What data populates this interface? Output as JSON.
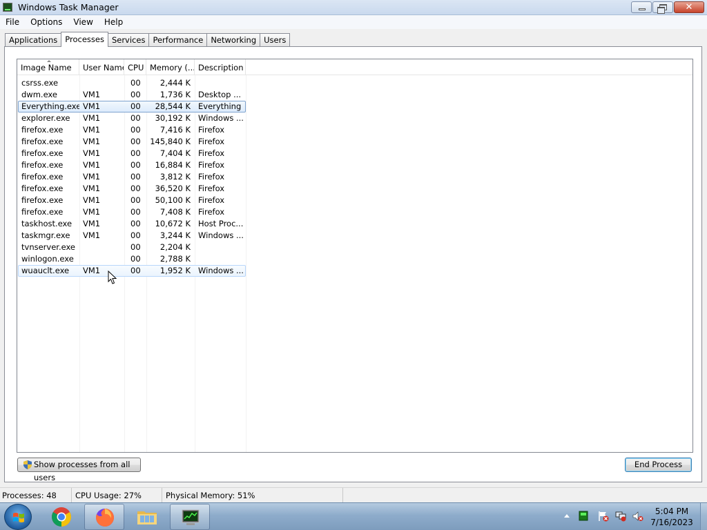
{
  "window": {
    "title": "Windows Task Manager",
    "minimize_icon": "minimize-icon",
    "maximize_icon": "restore-icon",
    "close_icon": "close-icon"
  },
  "menu": [
    "File",
    "Options",
    "View",
    "Help"
  ],
  "tabs": [
    {
      "label": "Applications",
      "active": false
    },
    {
      "label": "Processes",
      "active": true
    },
    {
      "label": "Services",
      "active": false
    },
    {
      "label": "Performance",
      "active": false
    },
    {
      "label": "Networking",
      "active": false
    },
    {
      "label": "Users",
      "active": false
    }
  ],
  "table": {
    "columns": [
      "Image Name",
      "User Name",
      "CPU",
      "Memory (...",
      "Description"
    ],
    "sorted_column": "Image Name",
    "rows": [
      {
        "name": "csrss.exe",
        "user": "",
        "cpu": "00",
        "mem": "2,444 K",
        "desc": ""
      },
      {
        "name": "dwm.exe",
        "user": "VM1",
        "cpu": "00",
        "mem": "1,736 K",
        "desc": "Desktop ..."
      },
      {
        "name": "Everything.exe",
        "user": "VM1",
        "cpu": "00",
        "mem": "28,544 K",
        "desc": "Everything",
        "state": "selected"
      },
      {
        "name": "explorer.exe",
        "user": "VM1",
        "cpu": "00",
        "mem": "30,192 K",
        "desc": "Windows ..."
      },
      {
        "name": "firefox.exe",
        "user": "VM1",
        "cpu": "00",
        "mem": "7,416 K",
        "desc": "Firefox"
      },
      {
        "name": "firefox.exe",
        "user": "VM1",
        "cpu": "00",
        "mem": "145,840 K",
        "desc": "Firefox"
      },
      {
        "name": "firefox.exe",
        "user": "VM1",
        "cpu": "00",
        "mem": "7,404 K",
        "desc": "Firefox"
      },
      {
        "name": "firefox.exe",
        "user": "VM1",
        "cpu": "00",
        "mem": "16,884 K",
        "desc": "Firefox"
      },
      {
        "name": "firefox.exe",
        "user": "VM1",
        "cpu": "00",
        "mem": "3,812 K",
        "desc": "Firefox"
      },
      {
        "name": "firefox.exe",
        "user": "VM1",
        "cpu": "00",
        "mem": "36,520 K",
        "desc": "Firefox"
      },
      {
        "name": "firefox.exe",
        "user": "VM1",
        "cpu": "00",
        "mem": "50,100 K",
        "desc": "Firefox"
      },
      {
        "name": "firefox.exe",
        "user": "VM1",
        "cpu": "00",
        "mem": "7,408 K",
        "desc": "Firefox"
      },
      {
        "name": "taskhost.exe",
        "user": "VM1",
        "cpu": "00",
        "mem": "10,672 K",
        "desc": "Host Proc..."
      },
      {
        "name": "taskmgr.exe",
        "user": "VM1",
        "cpu": "00",
        "mem": "3,244 K",
        "desc": "Windows ..."
      },
      {
        "name": "tvnserver.exe",
        "user": "",
        "cpu": "00",
        "mem": "2,204 K",
        "desc": ""
      },
      {
        "name": "winlogon.exe",
        "user": "",
        "cpu": "00",
        "mem": "2,788 K",
        "desc": ""
      },
      {
        "name": "wuauclt.exe",
        "user": "VM1",
        "cpu": "00",
        "mem": "1,952 K",
        "desc": "Windows ...",
        "state": "hover"
      }
    ]
  },
  "buttons": {
    "show_all": "Show processes from all users",
    "show_all_icon": "uac-shield-icon",
    "end_process": "End Process"
  },
  "status": {
    "processes": "Processes: 48",
    "cpu": "CPU Usage: 27%",
    "memory": "Physical Memory: 51%"
  },
  "taskbar": {
    "start_icon": "windows-start-icon",
    "apps": [
      {
        "name": "chrome",
        "icon": "chrome-icon",
        "active": false
      },
      {
        "name": "firefox",
        "icon": "firefox-icon",
        "active": true
      },
      {
        "name": "explorer",
        "icon": "folder-icon",
        "active": false
      },
      {
        "name": "taskmgr",
        "icon": "task-manager-icon",
        "active": true
      }
    ],
    "tray_icons": [
      "show-hidden-icons-arrow",
      "network-activity-icon",
      "action-center-flag-icon",
      "network-disconnected-icon",
      "volume-muted-icon"
    ],
    "time": "5:04 PM",
    "date": "7/16/2023"
  },
  "colors": {
    "selection_border": "#7da2ce",
    "selection_fill": "#dcebfc",
    "end_process_border": "#3c7fb1",
    "close_button": "#c7432b"
  }
}
